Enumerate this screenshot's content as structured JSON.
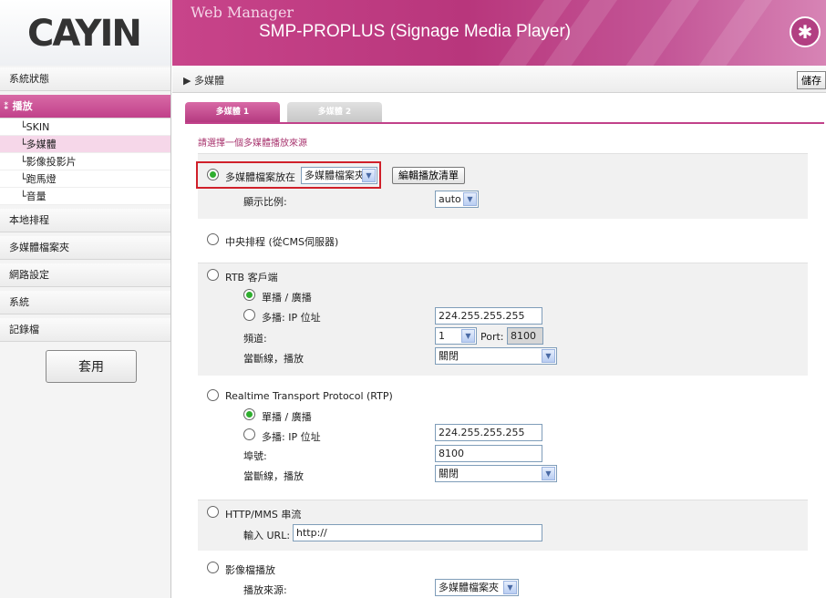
{
  "header": {
    "logo": "CAYIN",
    "title": "Web Manager",
    "subtitle": "SMP-PROPLUS (Signage Media Player)"
  },
  "sidebar": {
    "items": [
      {
        "label": "系統狀態"
      },
      {
        "label": "播放"
      },
      {
        "label": "本地排程"
      },
      {
        "label": "多媒體檔案夾"
      },
      {
        "label": "網路設定"
      },
      {
        "label": "系統"
      },
      {
        "label": "記錄檔"
      }
    ],
    "sub_items": [
      {
        "label": "└SKIN"
      },
      {
        "label": "└多媒體"
      },
      {
        "label": "└影像投影片"
      },
      {
        "label": "└跑馬燈"
      },
      {
        "label": "└音量"
      }
    ],
    "apply_label": "套用"
  },
  "main": {
    "breadcrumb": "▶ 多媒體",
    "save_label": "儲存",
    "tabs": [
      {
        "label": "多媒體 1"
      },
      {
        "label": "多媒體 2"
      }
    ],
    "hint": "請選擇一個多媒體播放來源",
    "sources": {
      "file": {
        "label": "多媒體檔案放在",
        "folder_value": "多媒體檔案夾",
        "edit_playlist_label": "編輯播放清單",
        "aspect_label": "顯示比例:",
        "aspect_value": "auto"
      },
      "cms": {
        "label": "中央排程 (從CMS伺服器)"
      },
      "rtb": {
        "label": "RTB 客戶端",
        "unicast_label": "單播 / 廣播",
        "multicast_label": "多播: IP 位址",
        "ip_value": "224.255.255.255",
        "channel_label": "頻道:",
        "channel_value": "1",
        "port_label": "Port:",
        "port_value": "8100",
        "disconnect_label": "當斷線，播放",
        "disconnect_value": "關閉"
      },
      "rtp": {
        "label": "Realtime Transport Protocol (RTP)",
        "unicast_label": "單播 / 廣播",
        "multicast_label": "多播: IP 位址",
        "ip_value": "224.255.255.255",
        "port_label": "埠號:",
        "port_value": "8100",
        "disconnect_label": "當斷線，播放",
        "disconnect_value": "關閉"
      },
      "http": {
        "label": "HTTP/MMS 串流",
        "url_label": "輸入 URL:",
        "url_value": "http://"
      },
      "video": {
        "label": "影像檔播放",
        "source_label": "播放來源:",
        "source_value": "多媒體檔案夾"
      }
    }
  },
  "colors": {
    "accent": "#c1418a",
    "highlight": "#d0202a",
    "radio_on": "#2fae2f"
  }
}
